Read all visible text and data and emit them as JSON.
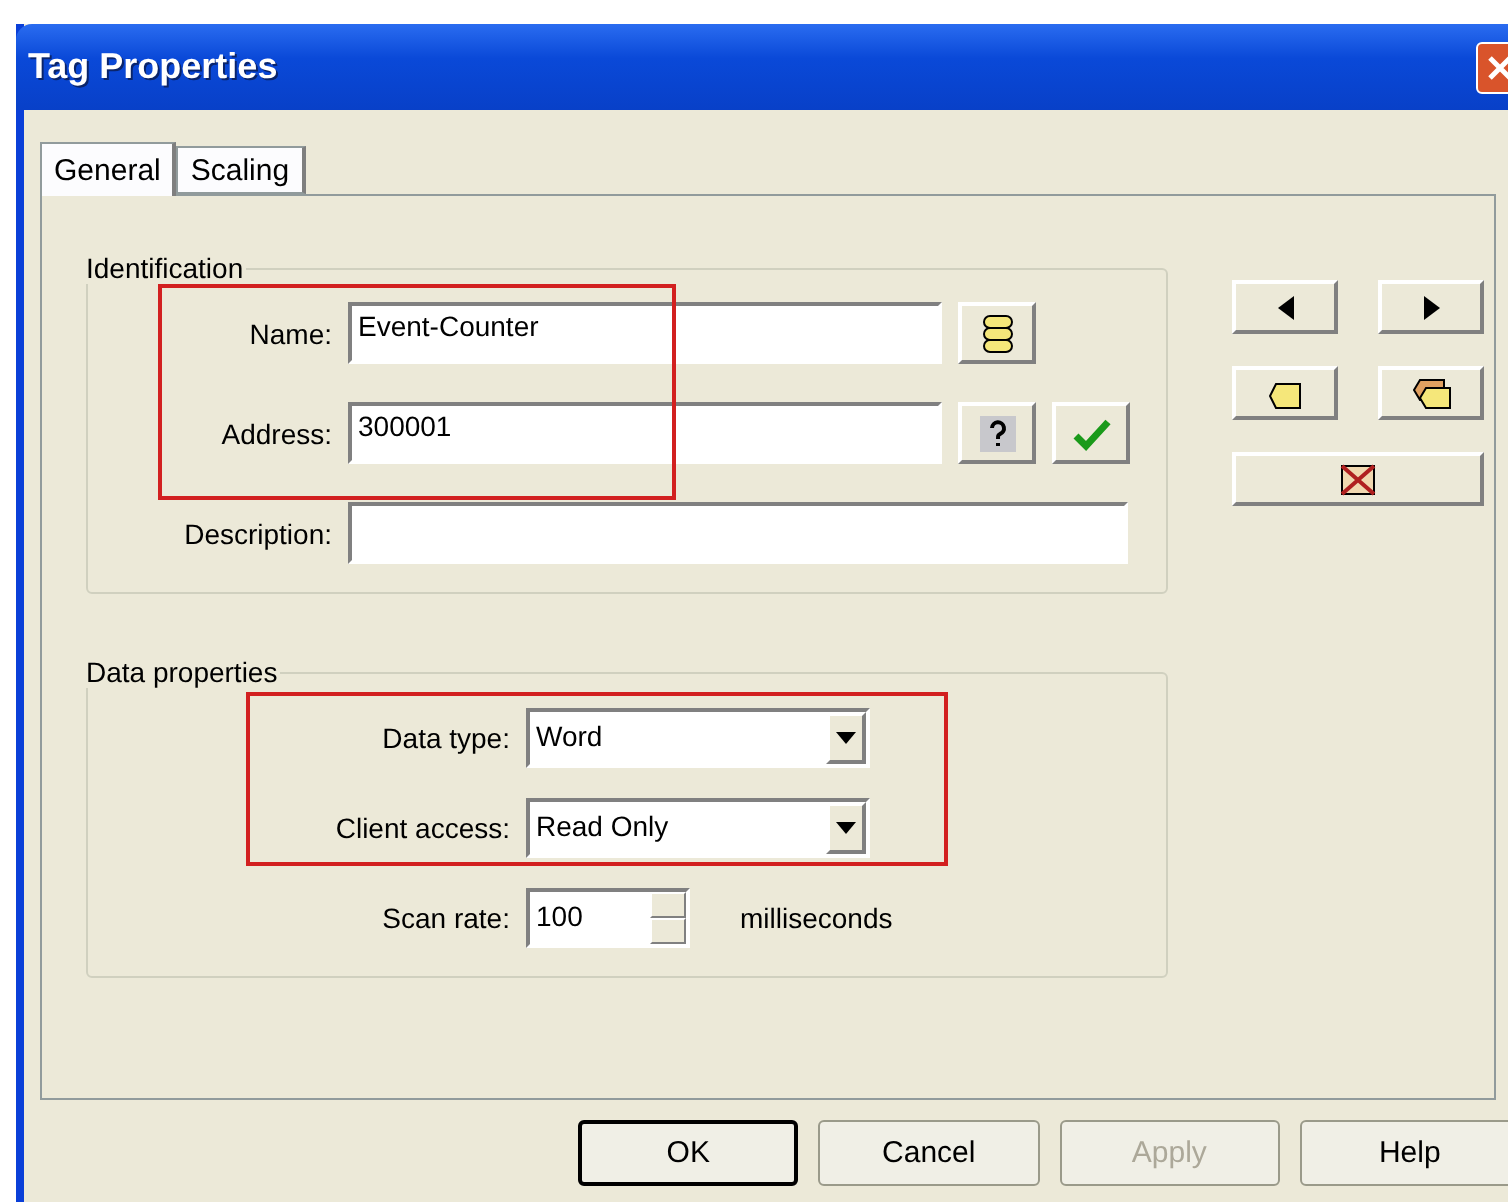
{
  "window": {
    "title": "Tag Properties"
  },
  "tabs": [
    {
      "label": "General",
      "selected": true
    },
    {
      "label": "Scaling",
      "selected": false
    }
  ],
  "identification": {
    "title": "Identification",
    "highlighted": true,
    "name": {
      "label": "Name:",
      "value": "Event-Counter"
    },
    "address": {
      "label": "Address:",
      "value": "300001"
    },
    "description": {
      "label": "Description:"
    }
  },
  "data_properties": {
    "title": "Data properties",
    "highlighted": true,
    "data_type": {
      "label": "Data type:",
      "value": "Word"
    },
    "client_access": {
      "label": "Client access:",
      "value": "Read Only"
    },
    "scan_rate": {
      "label": "Scan rate:",
      "value": "100",
      "unit": "milliseconds"
    }
  },
  "buttons": [
    {
      "label": "OK",
      "disabled": false,
      "default": true
    },
    {
      "label": "Cancel",
      "disabled": false,
      "default": false
    },
    {
      "label": "Apply",
      "disabled": true,
      "default": false
    },
    {
      "label": "Help",
      "disabled": false,
      "default": false
    }
  ]
}
